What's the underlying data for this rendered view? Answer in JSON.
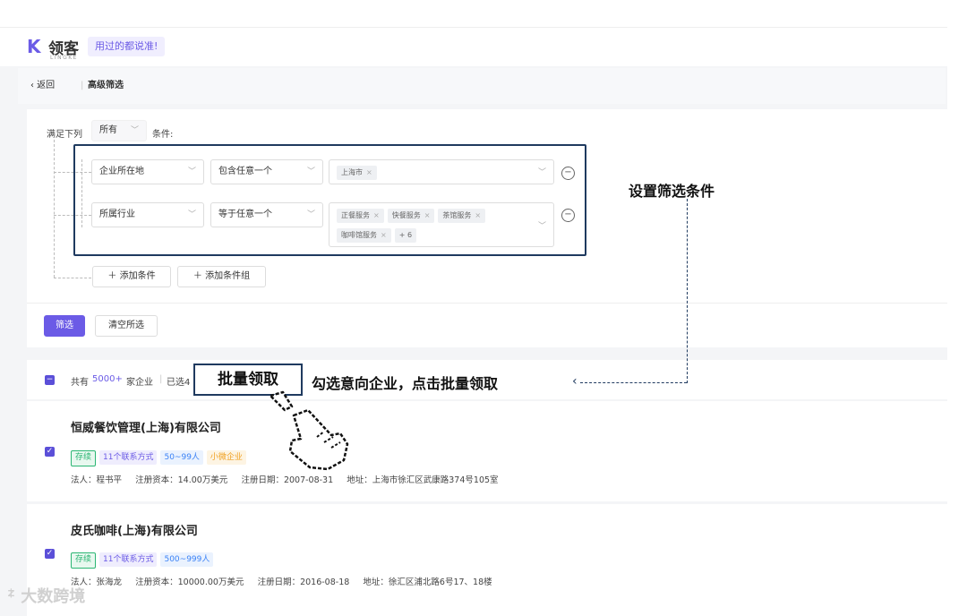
{
  "header": {
    "logo_mark": "K",
    "logo_text": "领客",
    "logo_sub": "LINGKE",
    "slogan": "用过的都说准!"
  },
  "breadcrumb": {
    "back": "‹ 返回",
    "title": "高级筛选"
  },
  "filter": {
    "match_prefix": "满足下列",
    "match_value": "所有",
    "match_suffix": "条件:",
    "rows": [
      {
        "field": "企业所在地",
        "operator": "包含任意一个",
        "tags": [
          "上海市"
        ]
      },
      {
        "field": "所属行业",
        "operator": "等于任意一个",
        "tags": [
          "正餐服务",
          "快餐服务",
          "茶馆服务",
          "咖啡馆服务"
        ],
        "more": "+ 6"
      }
    ],
    "add_condition": "添加条件",
    "add_condition_group": "添加条件组",
    "filter_button": "筛选",
    "clear_button": "清空所选"
  },
  "list": {
    "total_prefix": "共有",
    "total_count": "5000+",
    "total_suffix": "家企业",
    "selected_prefix": "已选4"
  },
  "companies": [
    {
      "name": "恒威餐饮管理(上海)有限公司",
      "tags": [
        {
          "label": "存续",
          "color": "#2bb673",
          "bg": "#e8f8ef",
          "border": "#2bb673"
        },
        {
          "label": "11个联系方式",
          "color": "#6b5be6",
          "bg": "#efedfd",
          "border": ""
        },
        {
          "label": "50~99人",
          "color": "#3b82f6",
          "bg": "#eaf2fe",
          "border": ""
        },
        {
          "label": "小微企业",
          "color": "#f0a020",
          "bg": "#fdf4e3",
          "border": ""
        }
      ],
      "legal_rep": "法人：程书平",
      "capital": "注册资本：14.00万美元",
      "reg_date": "注册日期：2007-08-31",
      "address": "地址：上海市徐汇区武康路374号105室"
    },
    {
      "name": "皮氏咖啡(上海)有限公司",
      "tags": [
        {
          "label": "存续",
          "color": "#2bb673",
          "bg": "#e8f8ef",
          "border": "#2bb673"
        },
        {
          "label": "11个联系方式",
          "color": "#6b5be6",
          "bg": "#efedfd",
          "border": ""
        },
        {
          "label": "500~999人",
          "color": "#3b82f6",
          "bg": "#eaf2fe",
          "border": ""
        }
      ],
      "legal_rep": "法人：张海龙",
      "capital": "注册资本：10000.00万美元",
      "reg_date": "注册日期：2016-08-18",
      "address": "地址：徐汇区浦北路6号17、18楼"
    }
  ],
  "annotations": {
    "set_conditions": "设置筛选条件",
    "batch_claim": "批量领取",
    "batch_hint": "勾选意向企业，点击批量领取"
  },
  "watermark": "大数跨境",
  "colors": {
    "accent": "#6b5be6",
    "annotation_border": "#1f3a5f"
  }
}
